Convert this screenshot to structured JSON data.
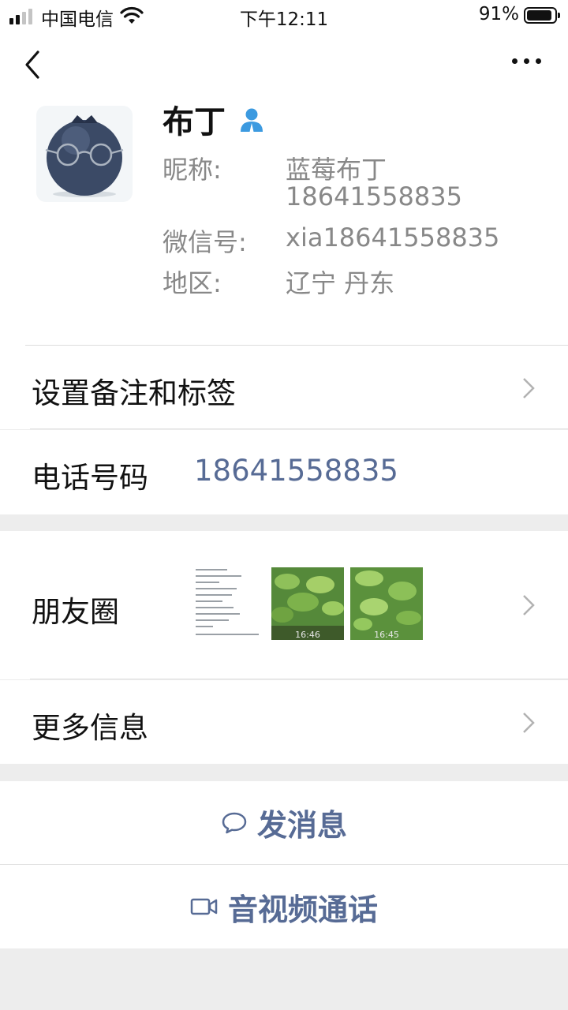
{
  "status_bar": {
    "carrier": "中国电信",
    "time": "下午12:11",
    "battery_percent": "91%",
    "battery_level": 0.91,
    "signal_bars_active": 2,
    "signal_bars_total": 4
  },
  "nav": {
    "back_icon": "chevron-left-icon",
    "more_icon": "more-dots-icon"
  },
  "profile": {
    "name": "布丁",
    "verified_icon": "person-icon",
    "nickname_label": "昵称:",
    "nickname_line1": "蓝莓布丁",
    "nickname_line2": "18641558835",
    "wechat_id_label": "微信号:",
    "wechat_id": "xia18641558835",
    "region_label": "地区:",
    "region": "辽宁 丹东"
  },
  "cells": {
    "remark_label": "设置备注和标签",
    "phone_label": "电话号码",
    "phone_value": "18641558835",
    "moments_label": "朋友圈",
    "moments_thumb_times": [
      "16:46",
      "16:45"
    ],
    "more_info_label": "更多信息"
  },
  "actions": {
    "message_label": "发消息",
    "call_label": "音视频通话"
  },
  "colors": {
    "link": "#576b95",
    "background": "#ededed",
    "cell": "#ffffff"
  }
}
